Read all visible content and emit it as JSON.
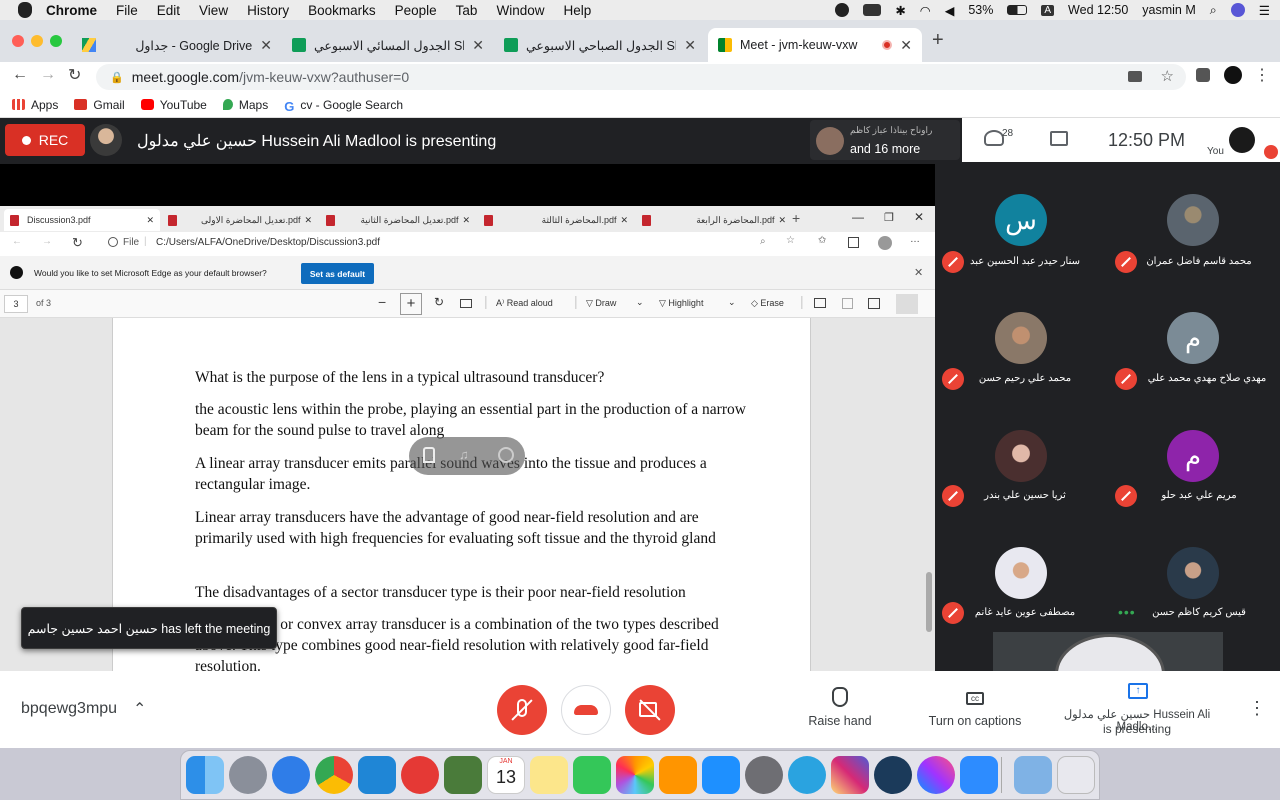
{
  "menubar": {
    "app": "Chrome",
    "items": [
      "File",
      "Edit",
      "View",
      "History",
      "Bookmarks",
      "People",
      "Tab",
      "Window",
      "Help"
    ],
    "battery": "53%",
    "keyboard": "A",
    "clock": "Wed 12:50",
    "user": "yasmin M"
  },
  "tabs": [
    {
      "title": "جداول - Google Drive",
      "icon": "drive-icon"
    },
    {
      "title": "الجدول المسائي الاسبوعي Sheets",
      "prefix": "gle Sheets",
      "icon": "sheets-icon"
    },
    {
      "title": "الجدول الصباحي الاسبوعي Sheets",
      "prefix": "le Sheets",
      "icon": "sheets-icon"
    },
    {
      "title": "Meet - jvm-keuw-vxw",
      "icon": "meet-icon"
    }
  ],
  "omnibox": {
    "host": "meet.google.com",
    "path": "/jvm-keuw-vxw?authuser=0"
  },
  "bookmarks": [
    {
      "label": "Apps",
      "icon": "apps-icon",
      "color": "#ea4335"
    },
    {
      "label": "Gmail",
      "icon": "gmail-icon",
      "color": "#d93025"
    },
    {
      "label": "YouTube",
      "icon": "youtube-icon",
      "color": "#ff0000"
    },
    {
      "label": "Maps",
      "icon": "maps-icon",
      "color": "#34a853"
    },
    {
      "label": "cv - Google Search",
      "icon": "google-icon",
      "color": "#4285f4"
    }
  ],
  "meet": {
    "rec_label": "REC",
    "presenting_text": "حسين علي مدلول Hussein Ali Madlool is presenting",
    "more_name": "راوناح بيناذا عباز كاظم",
    "more_count": "and 16 more",
    "participant_count": "28",
    "time": "12:50 PM",
    "you_label": "You",
    "meeting_code": "bpqewg3mpu",
    "raise_hand": "Raise hand",
    "captions": "Turn on captions",
    "presenter_short": "حسين علي مدلول Hussein Ali Madlo...",
    "presenter_status": "is presenting",
    "toast": "حسين احمد حسين جاسم has left the meeting"
  },
  "participants": [
    {
      "name": "سنار حيدر عبد الحسين عبد",
      "initial": "س",
      "color": "#11829e"
    },
    {
      "name": "محمد قاسم فاضل عمران",
      "initial": "",
      "color": "#6a7680"
    },
    {
      "name": "محمد علي رحيم حسن",
      "initial": "",
      "color": "#8a7868"
    },
    {
      "name": "مهدي صلاح مهدي محمد علي",
      "initial": "م",
      "color": "#7b8b96"
    },
    {
      "name": "ثريا حسين علي بندر",
      "initial": "",
      "color": "#5a4040"
    },
    {
      "name": "مريم علي عبد حلو",
      "initial": "م",
      "color": "#8e24aa"
    },
    {
      "name": "مصطفى عوين عايد غانم",
      "initial": "",
      "color": "#c8c8d8"
    },
    {
      "name": "قيس كريم كاظم حسن",
      "initial": "",
      "color": "#3a4a5a"
    }
  ],
  "edge": {
    "tabs": [
      {
        "title": "Discussion3.pdf"
      },
      {
        "title": "تعديل المحاضرة الاولى.pdf"
      },
      {
        "title": "تعديل المحاضرة الثانية.pdf"
      },
      {
        "title": "المحاضرة الثالثة.pdf"
      },
      {
        "title": "المحاضرة الرابعة.pdf"
      }
    ],
    "file_label": "File",
    "path": "C:/Users/ALFA/OneDrive/Desktop/Discussion3.pdf",
    "default_prompt": "Would you like to set Microsoft Edge as your default browser?",
    "set_default": "Set as default",
    "page_num": "3",
    "page_total": "of 3",
    "read_aloud": "Read aloud",
    "draw": "Draw",
    "highlight": "Highlight",
    "erase": "Erase"
  },
  "pdf_paragraphs": [
    "What is the purpose of the lens in a typical ultrasound transducer?",
    "the acoustic lens within the probe, playing an essential part in the production of a narrow beam for the sound pulse to travel along",
    "A linear array transducer emits parallel sound waves into the tissue and produces a rectangular image.",
    "Linear array transducers have the advantage of good near-field resolution and are primarily used with high frequencies for evaluating soft tissue and the thyroid gland",
    "The disadvantages of a sector transducer type is their poor near-field resolution",
    "A curvilinear or convex array transducer is a combination of the two types described above. This type combines good near-field resolution with relatively good far-field resolution."
  ],
  "dock": {
    "calendar_month": "JAN",
    "calendar_day": "13",
    "apps": [
      "finder-icon",
      "launchpad-icon",
      "safari-icon",
      "chrome-icon",
      "vscode-icon",
      "player-icon",
      "script-editor-icon",
      "calendar-icon",
      "notes-icon",
      "facetime-icon",
      "photos-icon",
      "books-icon",
      "appstore-icon",
      "system-preferences-icon",
      "telegram-icon",
      "instagram-icon",
      "qreader-icon",
      "messenger-icon",
      "zoom-icon",
      "downloads-folder-icon",
      "trash-icon"
    ]
  }
}
